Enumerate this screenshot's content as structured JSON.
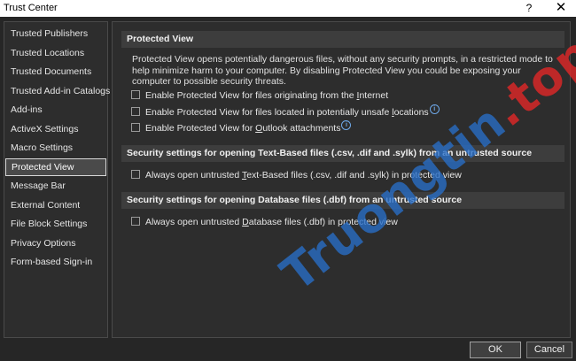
{
  "window": {
    "title": "Trust Center",
    "help": "?",
    "close": "✕"
  },
  "sidebar": {
    "items": [
      {
        "label": "Trusted Publishers"
      },
      {
        "label": "Trusted Locations"
      },
      {
        "label": "Trusted Documents"
      },
      {
        "label": "Trusted Add-in Catalogs"
      },
      {
        "label": "Add-ins"
      },
      {
        "label": "ActiveX Settings"
      },
      {
        "label": "Macro Settings"
      },
      {
        "label": "Protected View",
        "selected": true
      },
      {
        "label": "Message Bar"
      },
      {
        "label": "External Content"
      },
      {
        "label": "File Block Settings"
      },
      {
        "label": "Privacy Options"
      },
      {
        "label": "Form-based Sign-in"
      }
    ]
  },
  "protected_view": {
    "header": "Protected View",
    "description": "Protected View opens potentially dangerous files, without any security prompts, in a restricted mode to help minimize harm to your computer. By disabling Protected View you could be exposing your computer to possible security threats.",
    "opt_internet_pre": "Enable Protected View for files originating from the ",
    "opt_internet_key": "I",
    "opt_internet_post": "nternet",
    "opt_unsafe_pre": "Enable Protected View for files located in potentially unsafe ",
    "opt_unsafe_key": "l",
    "opt_unsafe_post": "ocations",
    "opt_outlook_pre": "Enable Protected View for ",
    "opt_outlook_key": "O",
    "opt_outlook_post": "utlook attachments"
  },
  "text_based": {
    "header": "Security settings for opening Text-Based files (.csv, .dif and .sylk) from an untrusted source",
    "opt_pre": "Always open untrusted ",
    "opt_key": "T",
    "opt_post": "ext-Based files (.csv, .dif and .sylk) in protected view"
  },
  "database": {
    "header": "Security settings for opening Database files (.dbf) from an untrusted source",
    "opt_pre": "Always open untrusted ",
    "opt_key": "D",
    "opt_post": "atabase files (.dbf) in protected view"
  },
  "buttons": {
    "ok": "OK",
    "cancel": "Cancel"
  },
  "icons": {
    "info": "info-icon"
  },
  "watermark": {
    "main": "Truongtin",
    "dot": ".top"
  },
  "colors": {
    "background": "#262626",
    "panel": "#2d2d2d",
    "section_header": "#3d3d3d",
    "selected_item": "#4a4a4a",
    "info_accent": "#6fa8e8"
  }
}
